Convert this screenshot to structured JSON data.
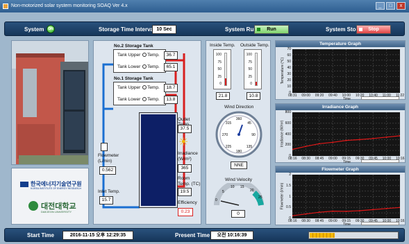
{
  "window": {
    "title": "Non-motorized solar system monitoring SOAQ Ver 4.x",
    "min": "_",
    "max": "□",
    "close": "x"
  },
  "top": {
    "system_label": "System",
    "system_led": "ON",
    "interval_label": "Storage Time Interval",
    "interval_value": "10 Sec",
    "run_label": "System Run",
    "run_button": "Run",
    "stop_label": "System Stop",
    "stop_button": "Stop"
  },
  "tanks": {
    "no2": {
      "title": "No.2 Storage Tank",
      "upper_label": "Tank Upper",
      "lower_label": "Tank Lower",
      "temp_word": "Temp.",
      "upper": "36.7",
      "lower": "65.1"
    },
    "no1": {
      "title": "No.1 Storage Tank",
      "upper_label": "Tank Upper",
      "lower_label": "Tank Lower",
      "temp_word": "Temp.",
      "upper": "18.7",
      "lower": "13.8"
    }
  },
  "readings": {
    "flowmeter_label": "Flowmeter (L/min)",
    "flowmeter": "0.562",
    "inlet_label": "Inlet Temp.",
    "inlet": "15.7",
    "outlet_label": "Outlet Temp.",
    "outlet": "37.5",
    "irradiance_label": "Irradiance (W/m²)",
    "irradiance": "365",
    "room_label": "Room Temp. (TC)",
    "room": "19.5",
    "efficiency_label": "Efficiency",
    "efficiency": "0.23"
  },
  "thermo": {
    "inside_label": "Inside Temp.",
    "outside_label": "Outside Temp.",
    "inside": "21.8",
    "outside": "10.8",
    "scale": [
      "100",
      "75",
      "50",
      "25",
      "0"
    ],
    "inside_level": 0.22,
    "outside_level": 0.11
  },
  "wind": {
    "dir_label": "Wind Direction",
    "dir_ticks": [
      "360",
      "315",
      "45",
      "270",
      "90",
      "225",
      "135",
      "180"
    ],
    "dir_value": "NNE",
    "vel_label": "Wind Velocity",
    "vel_ticks": [
      "0",
      "5",
      "10",
      "15",
      "20",
      "25"
    ],
    "vel_value": "0"
  },
  "graphs": {
    "temperature": {
      "title": "Temperature Graph",
      "ylabel": "Temperature (℃)",
      "yticks": [
        "70",
        "60",
        "50",
        "40",
        "30",
        "20",
        "10",
        "0"
      ],
      "xticks": [
        "08:31",
        "09:00",
        "09:20",
        "09:40",
        "10:00",
        "10:20",
        "10:40",
        "11:00",
        "11:22"
      ],
      "xlabel": "Time"
    },
    "irradiance": {
      "title": "Irradiance Graph",
      "ylabel": "Irradiance (W/m²)",
      "yticks": [
        "800",
        "600",
        "400",
        "200",
        "0"
      ],
      "xticks": [
        "08:16",
        "08:30",
        "08:45",
        "09:00",
        "09:15",
        "09:30",
        "09:45",
        "10:00",
        "10:16"
      ],
      "xlabel": "Time"
    },
    "flow": {
      "title": "Flowmeter Graph",
      "ylabel": "Flowmeter (l/min)",
      "yticks": [
        "2",
        "1.5",
        "1",
        "0.5",
        "0"
      ],
      "xticks": [
        "08:16",
        "08:30",
        "08:45",
        "09:00",
        "09:15",
        "09:30",
        "09:45",
        "10:00",
        "10:16"
      ],
      "xlabel": "Time"
    }
  },
  "chart_data": [
    {
      "type": "line",
      "title": "Temperature Graph",
      "ylabel": "Temperature (℃)",
      "xlabel": "Time",
      "ylim": [
        0,
        70
      ],
      "x": [],
      "series": []
    },
    {
      "type": "line",
      "title": "Irradiance Graph",
      "ylabel": "Irradiance (W/m²)",
      "xlabel": "Time",
      "ylim": [
        0,
        800
      ],
      "x": [
        "08:16",
        "08:30",
        "08:45",
        "09:00",
        "09:15",
        "09:30",
        "09:45",
        "10:00",
        "10:16"
      ],
      "series": [
        {
          "values": [
            120,
            175,
            225,
            250,
            285,
            300,
            320,
            345,
            370
          ]
        }
      ]
    },
    {
      "type": "line",
      "title": "Flowmeter Graph",
      "ylabel": "Flowmeter (l/min)",
      "xlabel": "Time",
      "ylim": [
        0,
        2
      ],
      "x": [
        "08:16",
        "08:30",
        "08:45",
        "09:00",
        "09:15",
        "09:30",
        "09:45",
        "10:00",
        "10:16"
      ],
      "series": [
        {
          "values": [
            0.12,
            0.2,
            0.28,
            0.33,
            0.32,
            0.35,
            0.4,
            0.45,
            0.5
          ]
        }
      ]
    }
  ],
  "logos": {
    "kier_name": "한국에너지기술연구원",
    "kier_sub": "KOREA INSTITUTE OF ENERGY RESEARCH",
    "dju_name": "대전대학교",
    "dju_sub": "DAEJEON UNIVERSITY"
  },
  "bottom": {
    "start_label": "Start Time",
    "start_value": "2016-11-15 오후 12:29:35",
    "present_label": "Present Time",
    "present_value": "오전 10:16:39",
    "progress": 0.28
  },
  "colors": {
    "bar": "#1f4670",
    "hot": "#d81f1f",
    "cold": "#1a6fd1",
    "collector": "#0d1f66",
    "trace": "#e01818"
  }
}
